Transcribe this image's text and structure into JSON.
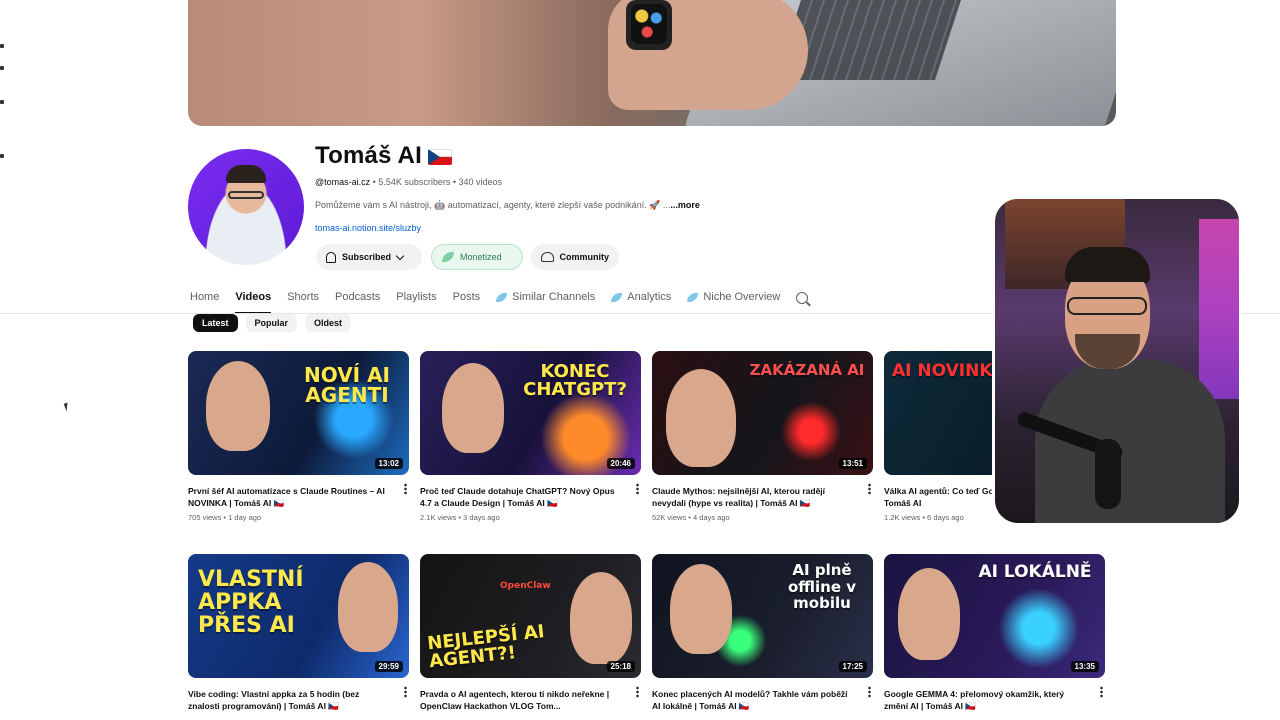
{
  "channel": {
    "name": "Tomáš AI",
    "handle": "@tomas-ai.cz",
    "subscribers": "5.54K subscribers",
    "videos_count": "340 videos",
    "description": "Pomůžeme vám s AI nástroji, 🤖 automatizací, agenty, které zlepší vaše podnikání. 🚀 ...",
    "more_label": "...more",
    "link": "tomas-ai.notion.site/sluzby"
  },
  "buttons": {
    "subscribed": "Subscribed",
    "monetized": "Monetized",
    "community": "Community"
  },
  "tabs": [
    "Home",
    "Videos",
    "Shorts",
    "Podcasts",
    "Playlists",
    "Posts",
    "Similar Channels",
    "Analytics",
    "Niche Overview"
  ],
  "chips": [
    "Latest",
    "Popular",
    "Oldest"
  ],
  "videos": [
    {
      "title": "První šéf AI automatizace s Claude Routines – AI NOVINKA | Tomáš AI 🇨🇿",
      "meta": "705 views • 1 day ago",
      "duration": "13:02",
      "thumb_text": "NOVÍ AI AGENTI"
    },
    {
      "title": "Proč teď Claude dotahuje ChatGPT? Nový Opus 4.7 a Claude Design | Tomáš AI 🇨🇿",
      "meta": "2.1K views • 3 days ago",
      "duration": "20:46",
      "thumb_text": "KONEC CHATGPT?"
    },
    {
      "title": "Claude Mythos: nejsilnější AI, kterou radějí nevydali (hype vs realita) | Tomáš AI 🇨🇿",
      "meta": "52K views • 4 days ago",
      "duration": "13:51",
      "thumb_text": "ZAKÁZANÁ AI"
    },
    {
      "title": "Válka AI agentů: Co teď Google AI a Claude | Tomáš AI",
      "meta": "1.2K views • 6 days ago",
      "duration": "",
      "thumb_text": "AI NOVINKY"
    },
    {
      "title": "Vibe coding: Vlastní appka za 5 hodin (bez znalosti programování) | Tomáš AI 🇨🇿",
      "meta": "",
      "duration": "29:59",
      "thumb_text": "VLASTNÍ APPKA PŘES AI"
    },
    {
      "title": "Pravda o AI agentech, kterou ti nikdo neřekne | OpenClaw Hackathon VLOG Tom...",
      "meta": "",
      "duration": "25:18",
      "thumb_text": "NEJLEPŠÍ AI AGENT?!"
    },
    {
      "title": "Konec placených AI modelů? Takhle vám poběží AI lokálně | Tomáš AI 🇨🇿",
      "meta": "",
      "duration": "17:25",
      "thumb_text": "AI plně offline v mobilu"
    },
    {
      "title": "Google GEMMA 4: přelomový okamžik, který změní AI | Tomáš AI 🇨🇿",
      "meta": "",
      "duration": "13:35",
      "thumb_text": "AI LOKÁLNĚ"
    }
  ],
  "thumb_extra": {
    "openclaw": "OpenClaw"
  },
  "colors": {
    "accent": "#0f0f0f",
    "link": "#065fd4",
    "monetized": "#2e7d4f"
  }
}
